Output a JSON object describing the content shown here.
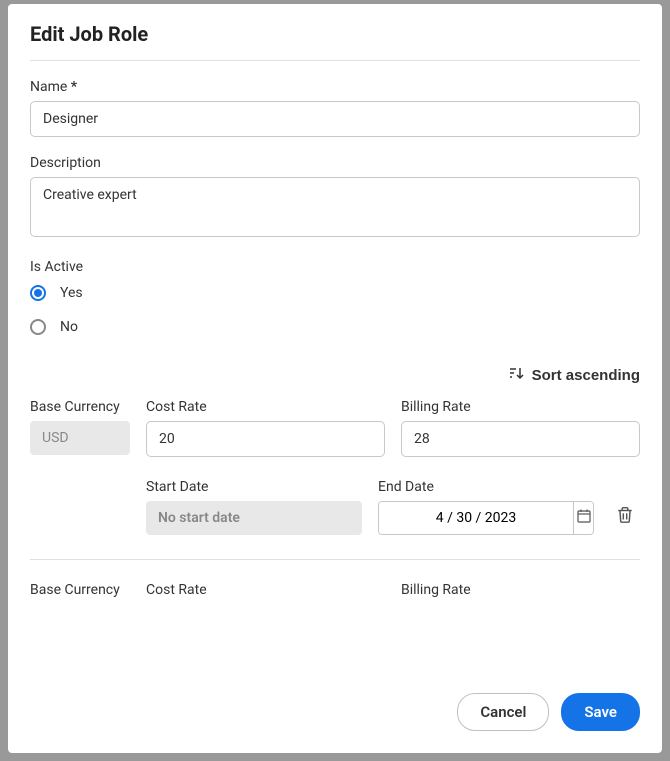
{
  "modal": {
    "title": "Edit Job Role",
    "name_label": "Name",
    "name_value": "Designer",
    "description_label": "Description",
    "description_value": "Creative expert",
    "is_active_label": "Is Active",
    "yes_label": "Yes",
    "no_label": "No",
    "sort_label": "Sort ascending",
    "base_currency_label": "Base Currency",
    "base_currency_value": "USD",
    "cost_rate_label": "Cost Rate",
    "cost_rate_value": "20",
    "billing_rate_label": "Billing Rate",
    "billing_rate_value": "28",
    "start_date_label": "Start Date",
    "start_date_placeholder": "No start date",
    "end_date_label": "End Date",
    "end_date_value": "4 / 30 / 2023",
    "base_currency_label2": "Base Currency",
    "cost_rate_label2": "Cost Rate",
    "billing_rate_label2": "Billing Rate",
    "cancel_label": "Cancel",
    "save_label": "Save"
  }
}
